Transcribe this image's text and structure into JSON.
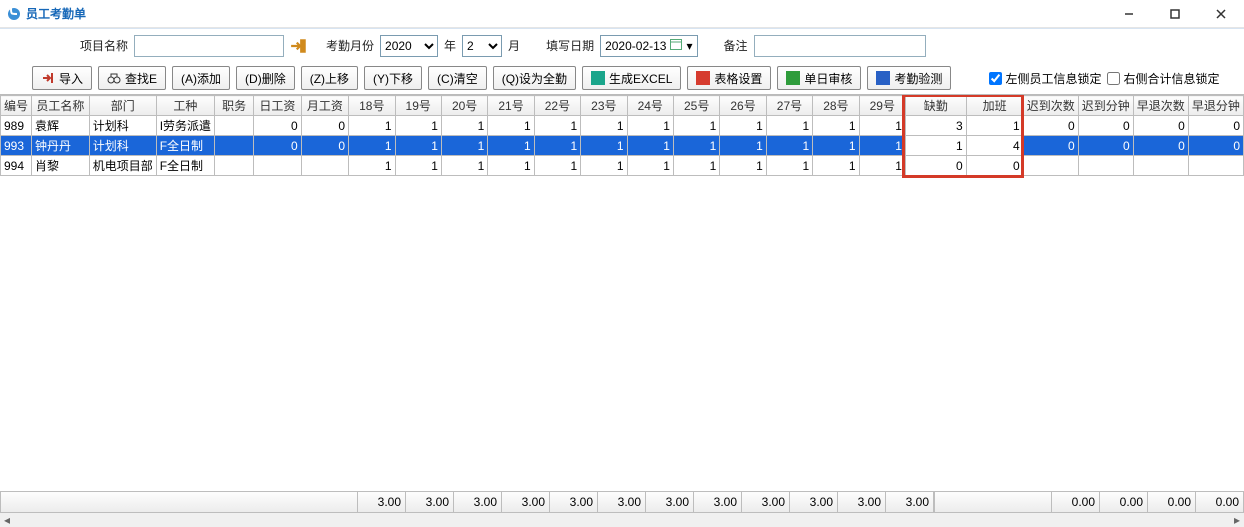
{
  "window": {
    "title": "员工考勤单"
  },
  "filter": {
    "project_label": "项目名称",
    "month_label": "考勤月份",
    "year_value": "2020",
    "year_suffix": "年",
    "month_value": "2",
    "month_suffix": "月",
    "fill_date_label": "填写日期",
    "fill_date_value": "2020-02-13",
    "remark_label": "备注"
  },
  "toolbar": {
    "import": "导入",
    "find": "查找E",
    "add": "(A)添加",
    "del": "(D)删除",
    "up": "(Z)上移",
    "down": "(Y)下移",
    "clear": "(C)清空",
    "full": "(Q)设为全勤",
    "excel": "生成EXCEL",
    "tblset": "表格设置",
    "audit": "单日审核",
    "verify": "考勤验测",
    "lock_left": "左侧员工信息锁定",
    "lock_right": "右侧合计信息锁定"
  },
  "columns": {
    "id": "编号",
    "name": "员工名称",
    "dept": "部门",
    "type": "工种",
    "pos": "职务",
    "daywage": "日工资",
    "monwage": "月工资",
    "d18": "18号",
    "d19": "19号",
    "d20": "20号",
    "d21": "21号",
    "d22": "22号",
    "d23": "23号",
    "d24": "24号",
    "d25": "25号",
    "d26": "26号",
    "d27": "27号",
    "d28": "28号",
    "d29": "29号",
    "absent": "缺勤",
    "overtime": "加班",
    "late_cnt": "迟到次数",
    "late_min": "迟到分钟",
    "early_cnt": "早退次数",
    "early_min": "早退分钟"
  },
  "rows": [
    {
      "id": "989",
      "name": "袁辉",
      "dept": "计划科",
      "type": "I劳务派遣",
      "pos": "",
      "daywage": "0",
      "monwage": "0",
      "days": [
        "1",
        "1",
        "1",
        "1",
        "1",
        "1",
        "1",
        "1",
        "1",
        "1",
        "1",
        "1"
      ],
      "absent": "3",
      "overtime": "1",
      "late_cnt": "0",
      "late_min": "0",
      "early_cnt": "0",
      "early_min": "0",
      "sel": false
    },
    {
      "id": "993",
      "name": "钟丹丹",
      "dept": "计划科",
      "type": "F全日制",
      "pos": "",
      "daywage": "0",
      "monwage": "0",
      "days": [
        "1",
        "1",
        "1",
        "1",
        "1",
        "1",
        "1",
        "1",
        "1",
        "1",
        "1",
        "1"
      ],
      "absent": "1",
      "overtime": "4",
      "late_cnt": "0",
      "late_min": "0",
      "early_cnt": "0",
      "early_min": "0",
      "sel": true
    },
    {
      "id": "994",
      "name": "肖黎",
      "dept": "机电项目部",
      "type": "F全日制",
      "pos": "",
      "daywage": "",
      "monwage": "",
      "days": [
        "1",
        "1",
        "1",
        "1",
        "1",
        "1",
        "1",
        "1",
        "1",
        "1",
        "1",
        "1"
      ],
      "absent": "0",
      "overtime": "0",
      "late_cnt": "",
      "late_min": "",
      "early_cnt": "",
      "early_min": "",
      "sel": false
    }
  ],
  "footer": {
    "days": [
      "3.00",
      "3.00",
      "3.00",
      "3.00",
      "3.00",
      "3.00",
      "3.00",
      "3.00",
      "3.00",
      "3.00",
      "3.00",
      "3.00"
    ],
    "late_cnt": "0.00",
    "late_min": "0.00",
    "early_cnt": "0.00",
    "early_min": "0.00"
  }
}
